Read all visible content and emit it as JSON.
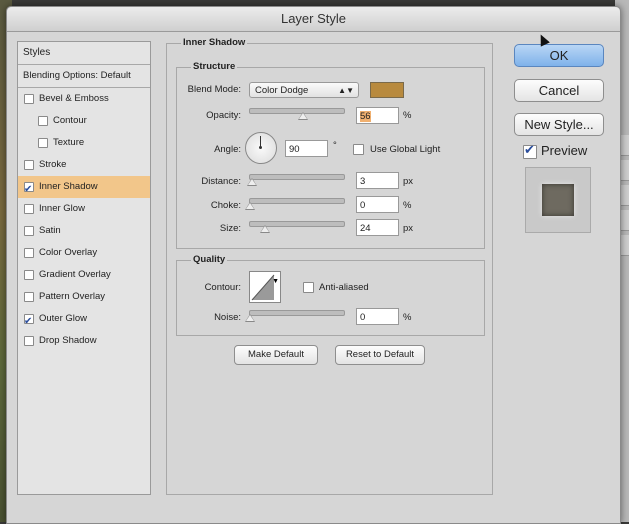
{
  "window": {
    "title": "Layer Style"
  },
  "styles_panel": {
    "header": "Styles",
    "blending_options": "Blending Options: Default",
    "items": [
      {
        "label": "Bevel & Emboss",
        "checked": false,
        "indent": 0,
        "selected": false
      },
      {
        "label": "Contour",
        "checked": false,
        "indent": 1,
        "selected": false
      },
      {
        "label": "Texture",
        "checked": false,
        "indent": 1,
        "selected": false
      },
      {
        "label": "Stroke",
        "checked": false,
        "indent": 0,
        "selected": false
      },
      {
        "label": "Inner Shadow",
        "checked": true,
        "indent": 0,
        "selected": true
      },
      {
        "label": "Inner Glow",
        "checked": false,
        "indent": 0,
        "selected": false
      },
      {
        "label": "Satin",
        "checked": false,
        "indent": 0,
        "selected": false
      },
      {
        "label": "Color Overlay",
        "checked": false,
        "indent": 0,
        "selected": false
      },
      {
        "label": "Gradient Overlay",
        "checked": false,
        "indent": 0,
        "selected": false
      },
      {
        "label": "Pattern Overlay",
        "checked": false,
        "indent": 0,
        "selected": false
      },
      {
        "label": "Outer Glow",
        "checked": true,
        "indent": 0,
        "selected": false
      },
      {
        "label": "Drop Shadow",
        "checked": false,
        "indent": 0,
        "selected": false
      }
    ]
  },
  "inner_shadow": {
    "title": "Inner Shadow",
    "structure": {
      "title": "Structure",
      "blend_mode_label": "Blend Mode:",
      "blend_mode_value": "Color Dodge",
      "blend_color": "#b88a3e",
      "opacity_label": "Opacity:",
      "opacity_value": "56",
      "opacity_fraction": 0.56,
      "opacity_unit": "%",
      "angle_label": "Angle:",
      "angle_value": "90",
      "angle_unit": "°",
      "global_light_label": "Use Global Light",
      "global_light_checked": false,
      "distance_label": "Distance:",
      "distance_value": "3",
      "distance_unit": "px",
      "choke_label": "Choke:",
      "choke_value": "0",
      "choke_unit": "%",
      "size_label": "Size:",
      "size_value": "24",
      "size_unit": "px"
    },
    "quality": {
      "title": "Quality",
      "contour_label": "Contour:",
      "anti_aliased_label": "Anti-aliased",
      "anti_aliased_checked": false,
      "noise_label": "Noise:",
      "noise_value": "0",
      "noise_unit": "%"
    },
    "make_default_label": "Make Default",
    "reset_default_label": "Reset to Default"
  },
  "actions": {
    "ok_label": "OK",
    "cancel_label": "Cancel",
    "new_style_label": "New Style...",
    "preview_label": "Preview",
    "preview_checked": true
  },
  "icons": [
    "checkbox-checked-icon",
    "dropdown-arrow-icon",
    "angle-dial-icon",
    "slider-thumb-icon",
    "contour-curve-icon",
    "mouse-cursor-icon"
  ]
}
